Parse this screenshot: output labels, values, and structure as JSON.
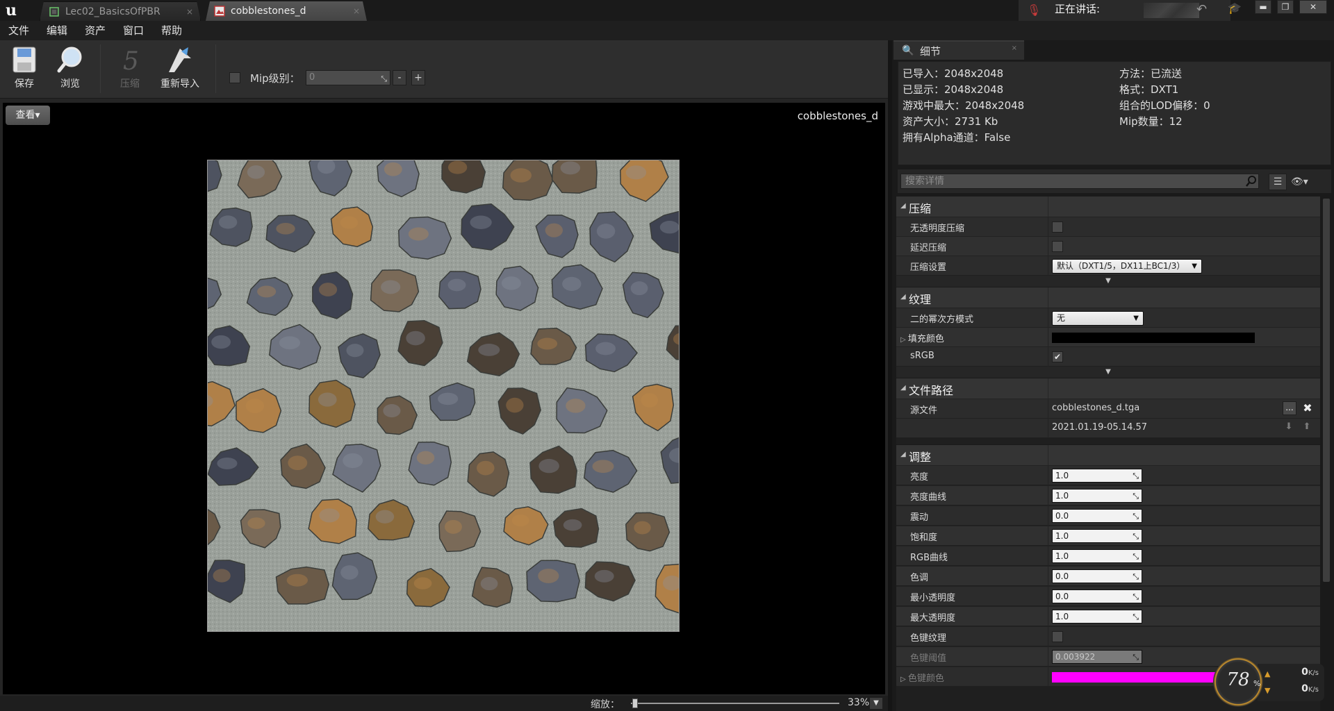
{
  "titlebar": {
    "tabs": [
      {
        "label": "Lec02_BasicsOfPBR",
        "close": "×"
      },
      {
        "label": "cobblestones_d",
        "close": "×"
      }
    ],
    "talking_label": "正在讲话:",
    "window_controls": {
      "minimize": "▬",
      "maximize": "❐",
      "close": "✕"
    }
  },
  "menu": [
    "文件",
    "编辑",
    "资产",
    "窗口",
    "帮助"
  ],
  "toolbar": {
    "save_label": "保存",
    "browse_label": "浏览",
    "compress_label": "压缩",
    "reimport_label": "重新导入",
    "mip_label": "Mip级别：",
    "mip_value": "0",
    "mip_minus": "-",
    "mip_plus": "+"
  },
  "viewport": {
    "view_button": "查看▾",
    "texture_name": "cobblestones_d"
  },
  "zoom": {
    "label": "缩放：",
    "value": "33%",
    "slider_fraction": 0.02
  },
  "details": {
    "tab_title": "细节",
    "tab_close": "×",
    "info_left": [
      "已导入：2048x2048",
      "已显示：2048x2048",
      "游戏中最大：2048x2048",
      "资产大小：2731 Kb",
      "拥有Alpha通道：False"
    ],
    "info_right": [
      "方法：已流送",
      "格式：DXT1",
      "组合的LOD偏移：0",
      "Mip数量：12"
    ],
    "search_placeholder": "搜索详情",
    "list_view_icon": "☰",
    "eye_icon": "👁▾",
    "sections": {
      "compression": {
        "title": "压缩",
        "no_alpha": "无透明度压缩",
        "defer": "延迟压缩",
        "settings": "压缩设置",
        "settings_value": "默认（DXT1/5，DX11上BC1/3）"
      },
      "texture": {
        "title": "纹理",
        "pow2": "二的幂次方模式",
        "pow2_value": "无",
        "pad_color": "填充颜色",
        "pad_color_value": "#000000",
        "srgb": "sRGB",
        "srgb_check": "✔"
      },
      "filepath": {
        "title": "文件路径",
        "source": "源文件",
        "source_file": "cobblestones_d.tga",
        "timestamp": "2021.01.19-05.14.57",
        "browse": "...",
        "clear": "✖"
      },
      "adjust": {
        "title": "调整",
        "rows": [
          {
            "label": "亮度",
            "value": "1.0"
          },
          {
            "label": "亮度曲线",
            "value": "1.0"
          },
          {
            "label": "震动",
            "value": "0.0"
          },
          {
            "label": "饱和度",
            "value": "1.0"
          },
          {
            "label": "RGB曲线",
            "value": "1.0"
          },
          {
            "label": "色调",
            "value": "0.0"
          },
          {
            "label": "最小透明度",
            "value": "0.0"
          },
          {
            "label": "最大透明度",
            "value": "1.0"
          }
        ],
        "chroma_key": "色键纹理",
        "chroma_threshold": "色键阈值",
        "chroma_threshold_value": "0.003922",
        "chroma_color": "色键颜色",
        "chroma_color_value": "#ff00ff"
      }
    }
  },
  "net_meter": {
    "percent": "78",
    "percent_sign": "%",
    "up_value": "0",
    "down_value": "0",
    "unit": "K/s"
  },
  "colors": {
    "accent": "#d8a024",
    "chroma_key": "#ff00ff",
    "panel_bg": "#2c2c2c",
    "viewport_bg": "#000000"
  }
}
